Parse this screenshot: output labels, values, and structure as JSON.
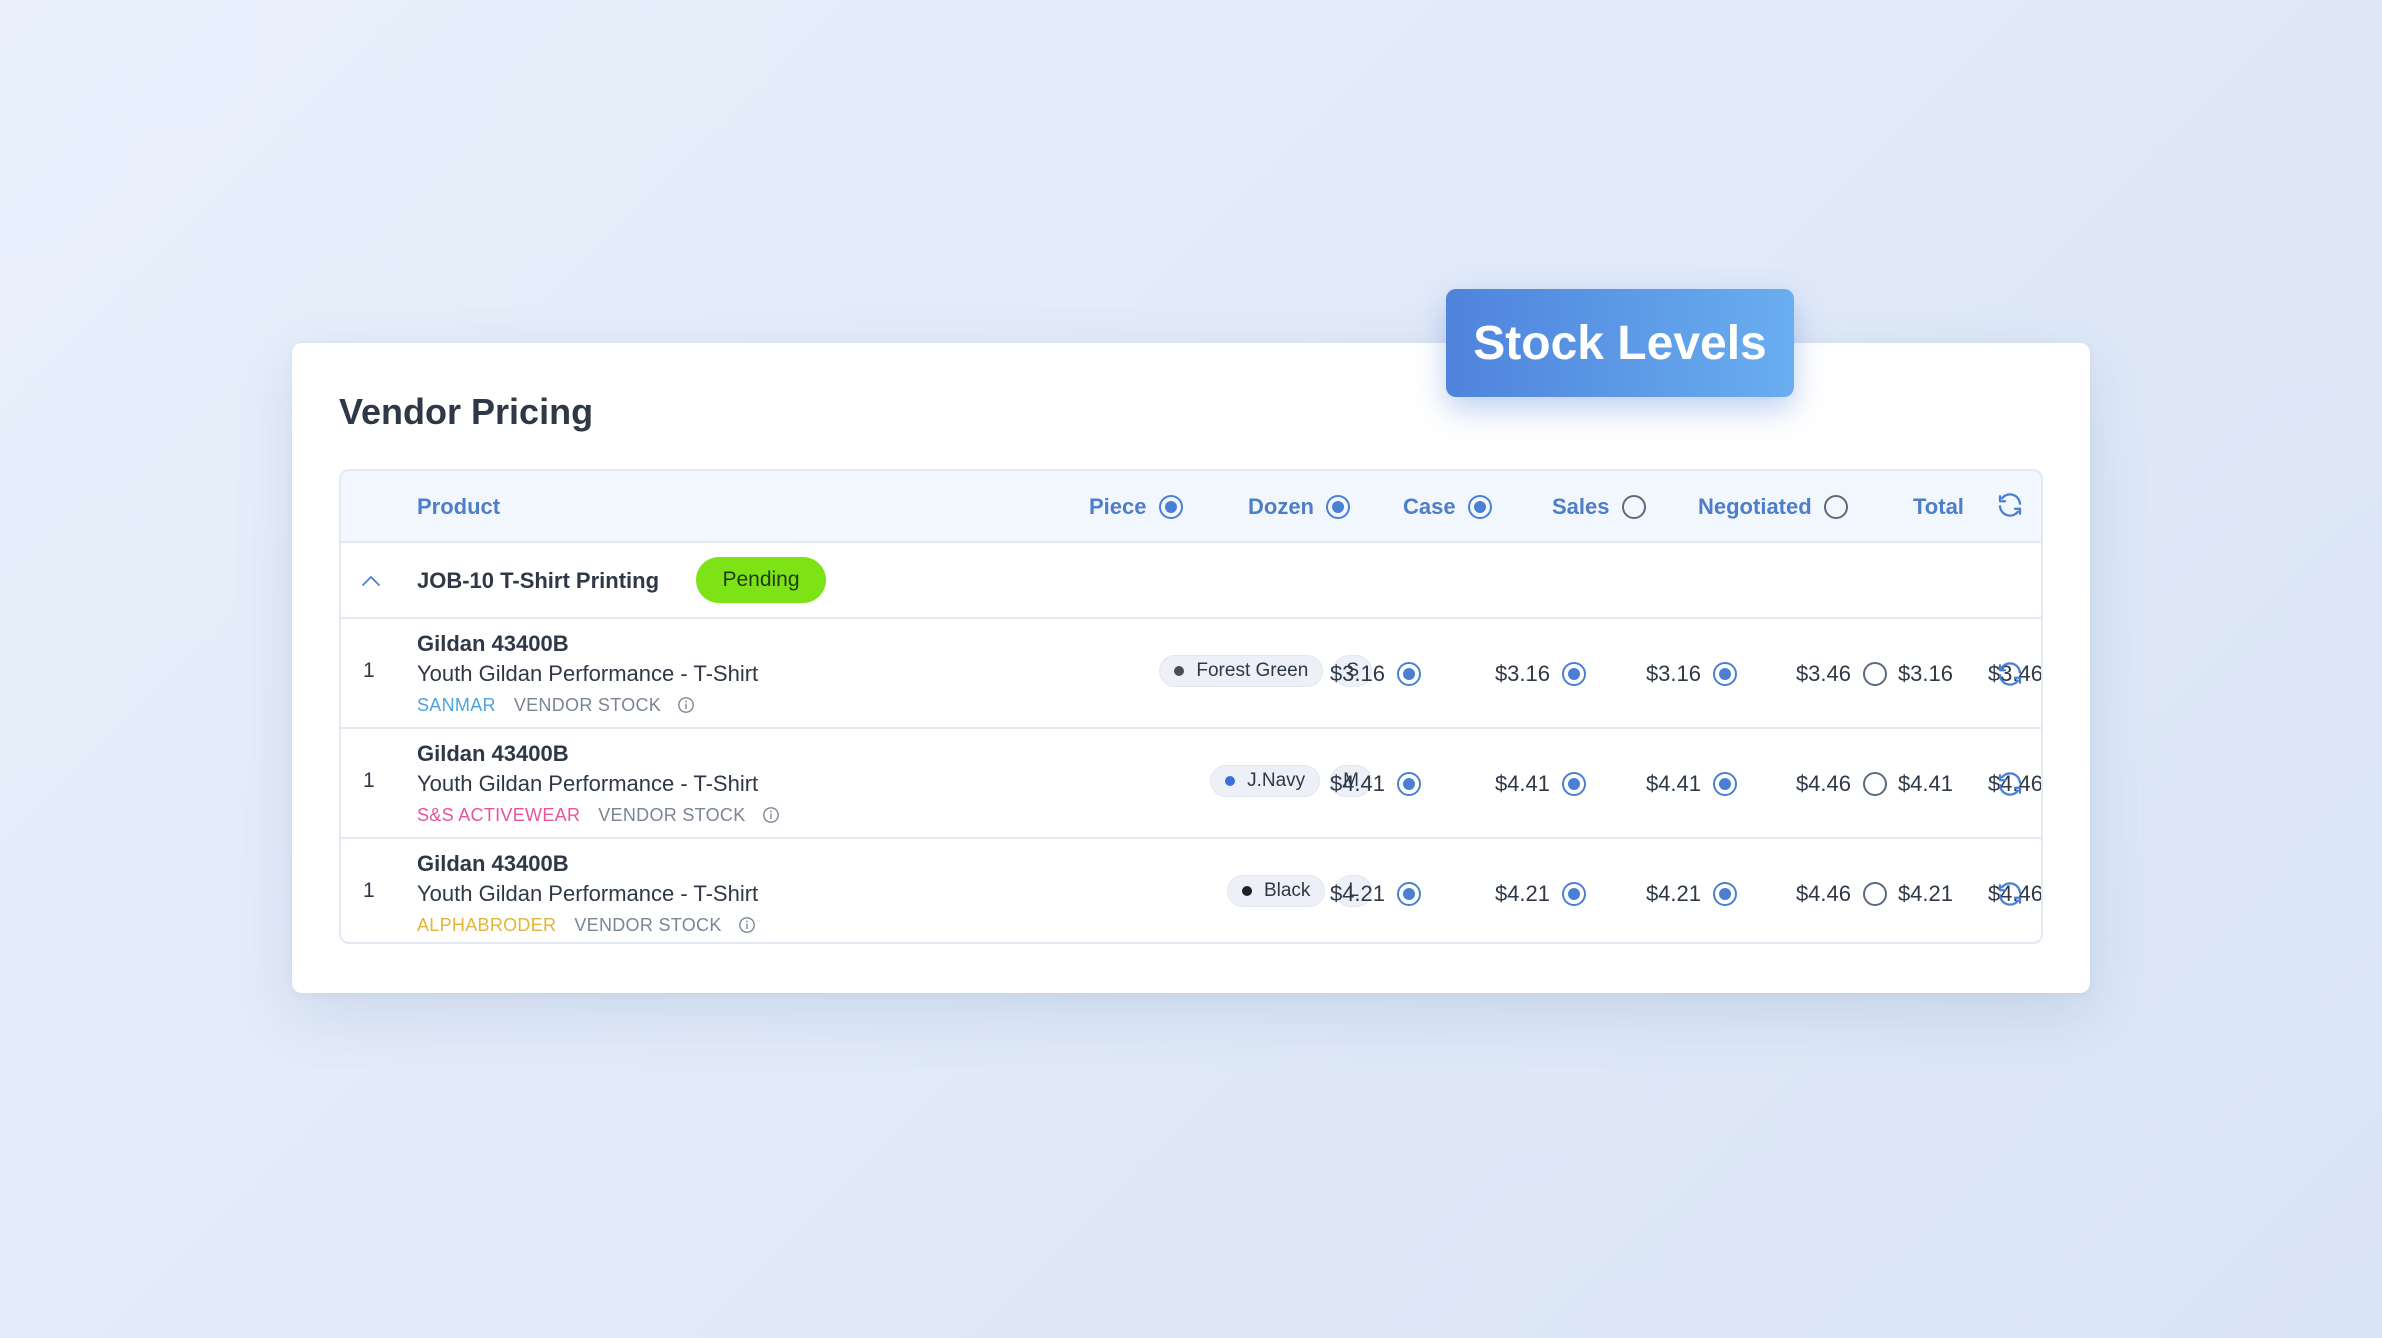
{
  "card": {
    "title": "Vendor Pricing"
  },
  "overlay": {
    "stock_label": "Stock Levels"
  },
  "table": {
    "headers": {
      "product": "Product",
      "piece": "Piece",
      "dozen": "Dozen",
      "case": "Case",
      "sales": "Sales",
      "negotiated": "Negotiated",
      "total": "Total"
    },
    "header_radio_selected": {
      "piece": true,
      "dozen": true,
      "case": true,
      "sales": false,
      "negotiated": false
    },
    "group": {
      "title": "JOB-10 T-Shirt Printing",
      "status": "Pending",
      "status_color": "#7de317"
    },
    "rows": [
      {
        "qty": "1",
        "name": "Gildan 43400B",
        "description": "Youth Gildan Performance - T-Shirt",
        "vendor": "SANMAR",
        "vendor_color": "#4da3dd",
        "stock_label": "VENDOR STOCK",
        "color_name": "Forest Green",
        "color_dot": "#4a4f57",
        "size": "S",
        "piece": "$3.16",
        "dozen": "$3.16",
        "case": "$3.16",
        "sales": "$3.46",
        "negotiated": "$3.46",
        "total": "$3.16"
      },
      {
        "qty": "1",
        "name": "Gildan 43400B",
        "description": "Youth Gildan Performance - T-Shirt",
        "vendor": "S&S ACTIVEWEAR",
        "vendor_color": "#e8559c",
        "stock_label": "VENDOR STOCK",
        "color_name": "J.Navy",
        "color_dot": "#3b6fd8",
        "size": "M",
        "piece": "$4.41",
        "dozen": "$4.41",
        "case": "$4.41",
        "sales": "$4.46",
        "negotiated": "$4.46",
        "total": "$4.41"
      },
      {
        "qty": "1",
        "name": "Gildan 43400B",
        "description": "Youth Gildan Performance - T-Shirt",
        "vendor": "ALPHABRODER",
        "vendor_color": "#e0b53a",
        "stock_label": "VENDOR STOCK",
        "color_name": "Black",
        "color_dot": "#1d232c",
        "size": "L",
        "piece": "$4.21",
        "dozen": "$4.21",
        "case": "$4.21",
        "sales": "$4.46",
        "negotiated": "$4.46",
        "total": "$4.21"
      }
    ]
  },
  "icons": {
    "refresh": "refresh-icon",
    "chevron": "chevron-up-icon",
    "info": "info-icon"
  },
  "colors": {
    "accent": "#4a7fd6",
    "header_text": "#4f7ec9",
    "badge_gradient_start": "#4f83dc",
    "badge_gradient_end": "#69aef0"
  }
}
